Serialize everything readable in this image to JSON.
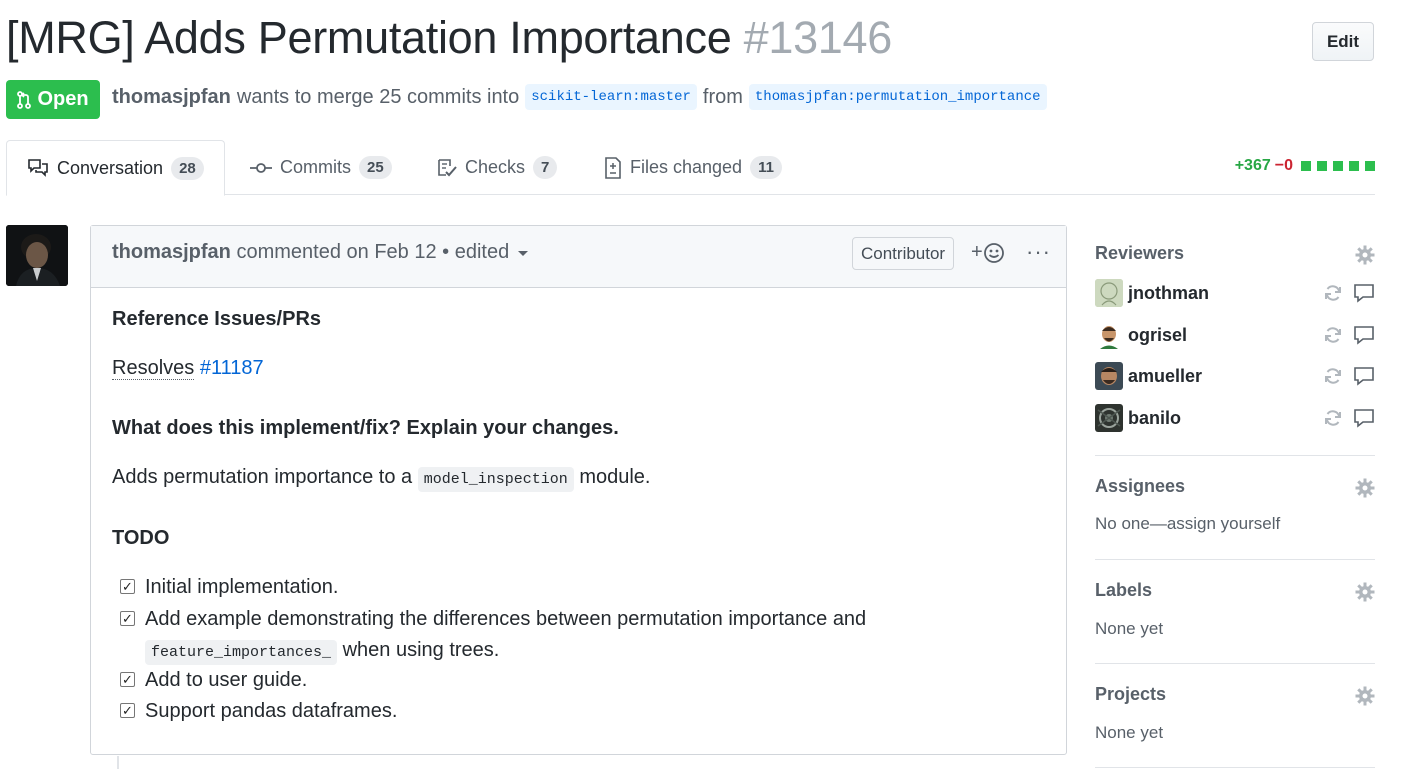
{
  "header": {
    "title": "[MRG] Adds Permutation Importance",
    "number": "#13146",
    "edit_label": "Edit"
  },
  "state": {
    "label": "Open",
    "color": "#2cbe4e"
  },
  "meta": {
    "author": "thomasjpfan",
    "text_before": "wants to merge 25 commits into",
    "base_branch": "scikit-learn:master",
    "from_text": "from",
    "head_branch": "thomasjpfan:permutation_importance"
  },
  "tabs": [
    {
      "label": "Conversation",
      "count": "28",
      "icon": "comment-discussion-icon"
    },
    {
      "label": "Commits",
      "count": "25",
      "icon": "git-commit-icon"
    },
    {
      "label": "Checks",
      "count": "7",
      "icon": "checklist-icon"
    },
    {
      "label": "Files changed",
      "count": "11",
      "icon": "file-diff-icon"
    }
  ],
  "diffstat": {
    "additions": "+367",
    "deletions": "−0"
  },
  "comment": {
    "author": "thomasjpfan",
    "action": "commented on Feb 12 • edited",
    "badge": "Contributor",
    "react_label": "+",
    "more_label": "···",
    "heading1": "Reference Issues/PRs",
    "resolves_label": "Resolves",
    "issue_link": "#11187",
    "heading2": "What does this implement/fix? Explain your changes.",
    "para_before": "Adds permutation importance to a",
    "para_code": "model_inspection",
    "para_after": "module.",
    "heading3": "TODO",
    "tasks": [
      {
        "text": "Initial implementation.",
        "checked": true
      },
      {
        "text": "Add example demonstrating the differences between permutation importance and",
        "code": "feature_importances_",
        "after": "when using trees.",
        "checked": true
      },
      {
        "text": "Add to user guide.",
        "checked": true
      },
      {
        "text": "Support pandas dataframes.",
        "checked": true
      }
    ]
  },
  "sidebar": {
    "reviewers_title": "Reviewers",
    "reviewers": [
      "jnothman",
      "ogrisel",
      "amueller",
      "banilo"
    ],
    "assignees_title": "Assignees",
    "assignees_value": "No one—assign yourself",
    "labels_title": "Labels",
    "labels_value": "None yet",
    "projects_title": "Projects",
    "projects_value": "None yet"
  }
}
